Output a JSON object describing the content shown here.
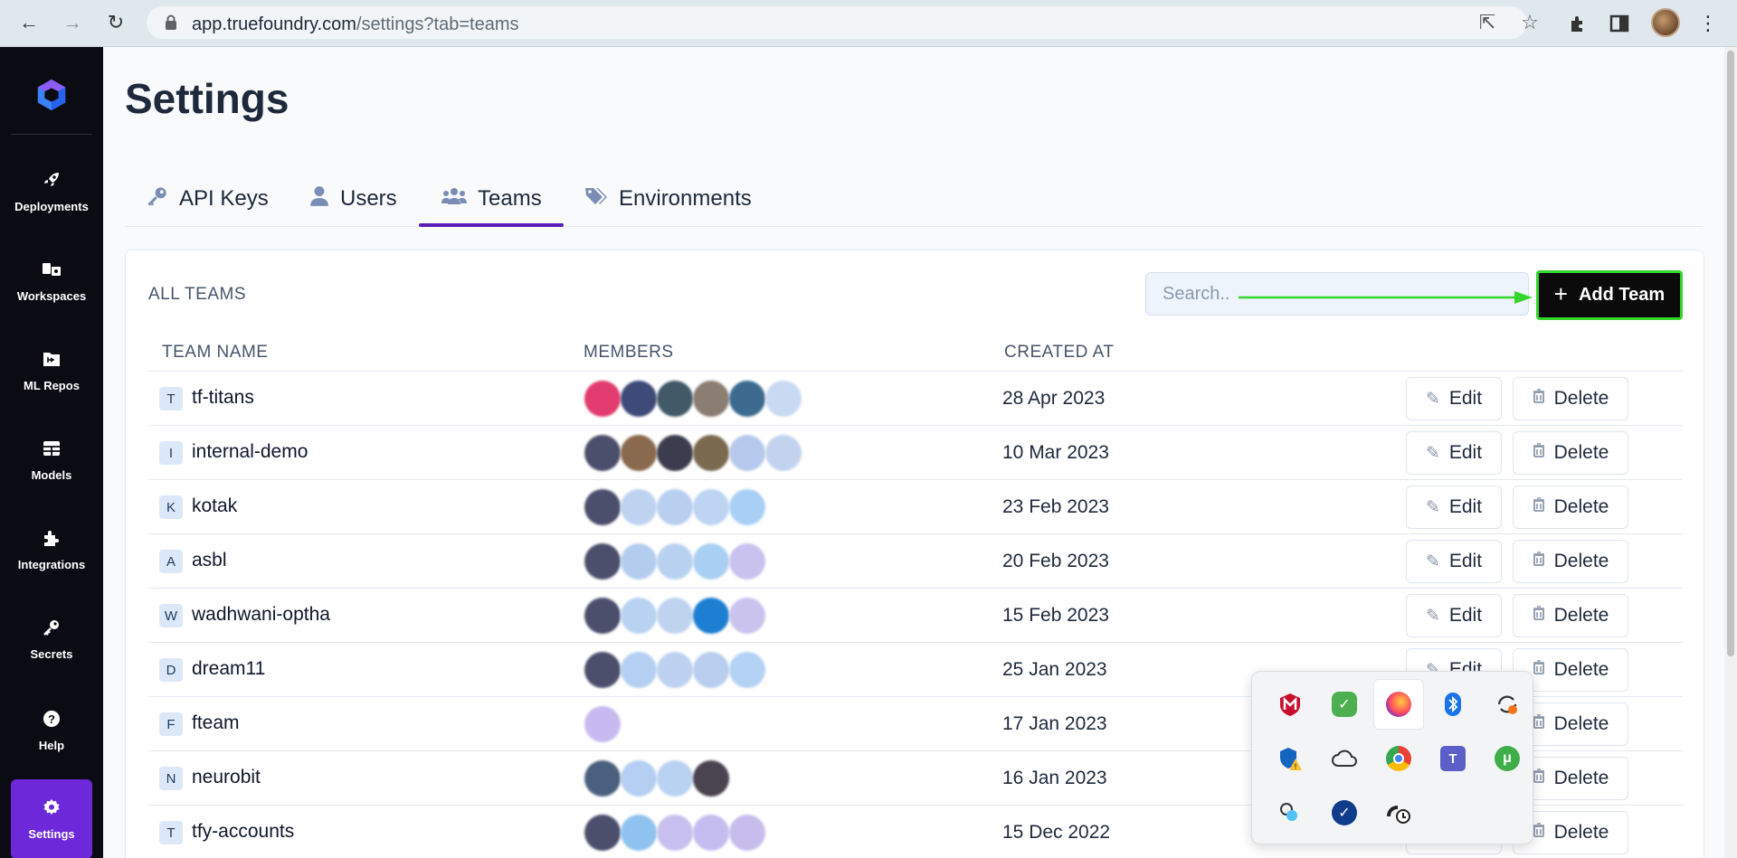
{
  "browser": {
    "url_host": "app.truefoundry.com",
    "url_path": "/settings?tab=teams"
  },
  "sidebar": {
    "items": [
      {
        "label": "Deployments",
        "icon": "rocket-icon"
      },
      {
        "label": "Workspaces",
        "icon": "workspaces-icon"
      },
      {
        "label": "ML Repos",
        "icon": "folder-icon"
      },
      {
        "label": "Models",
        "icon": "table-icon"
      },
      {
        "label": "Integrations",
        "icon": "puzzle-icon"
      },
      {
        "label": "Secrets",
        "icon": "key-icon"
      },
      {
        "label": "Help",
        "icon": "help-icon"
      },
      {
        "label": "Settings",
        "icon": "gear-icon",
        "active": true
      }
    ]
  },
  "page": {
    "title": "Settings"
  },
  "tabs": [
    {
      "label": "API Keys",
      "icon": "key-icon"
    },
    {
      "label": "Users",
      "icon": "user-icon"
    },
    {
      "label": "Teams",
      "icon": "users-icon",
      "active": true
    },
    {
      "label": "Environments",
      "icon": "tags-icon"
    }
  ],
  "teams": {
    "heading": "ALL TEAMS",
    "search_placeholder": "Search..",
    "add_label": "Add Team",
    "columns": [
      "TEAM NAME",
      "MEMBERS",
      "CREATED AT"
    ],
    "edit_label": "Edit",
    "delete_label": "Delete",
    "rows": [
      {
        "letter": "T",
        "name": "tf-titans",
        "created": "28 Apr 2023"
      },
      {
        "letter": "I",
        "name": "internal-demo",
        "created": "10 Mar 2023"
      },
      {
        "letter": "K",
        "name": "kotak",
        "created": "23 Feb 2023"
      },
      {
        "letter": "A",
        "name": "asbl",
        "created": "20 Feb 2023"
      },
      {
        "letter": "W",
        "name": "wadhwani-optha",
        "created": "15 Feb 2023"
      },
      {
        "letter": "D",
        "name": "dream11",
        "created": "25 Jan 2023"
      },
      {
        "letter": "F",
        "name": "fteam",
        "created": "17 Jan 2023"
      },
      {
        "letter": "N",
        "name": "neurobit",
        "created": "16 Jan 2023"
      },
      {
        "letter": "T",
        "name": "tfy-accounts",
        "created": "15 Dec 2022"
      }
    ]
  },
  "colors": {
    "accent": "#5b21b6",
    "sidebar_bg": "#0b0b14",
    "highlight": "#34d62d"
  }
}
